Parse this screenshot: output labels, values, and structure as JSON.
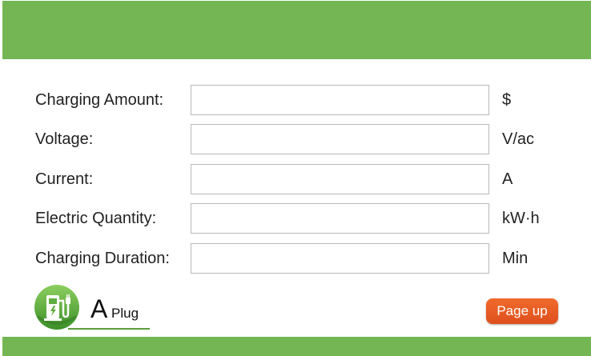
{
  "form": {
    "rows": [
      {
        "label": "Charging Amount:",
        "value": "",
        "unit": "$"
      },
      {
        "label": "Voltage:",
        "value": "",
        "unit": "V/ac"
      },
      {
        "label": "Current:",
        "value": "",
        "unit": "A"
      },
      {
        "label": "Electric Quantity:",
        "value": "",
        "unit": "kW·h"
      },
      {
        "label": "Charging Duration:",
        "value": "",
        "unit": "Min"
      }
    ]
  },
  "plug": {
    "letter": "A",
    "word": "Plug",
    "icon": "ev-charger-icon"
  },
  "nav": {
    "page_up_label": "Page up"
  },
  "colors": {
    "bar_green": "#75b654",
    "button_orange": "#ea5a24"
  }
}
